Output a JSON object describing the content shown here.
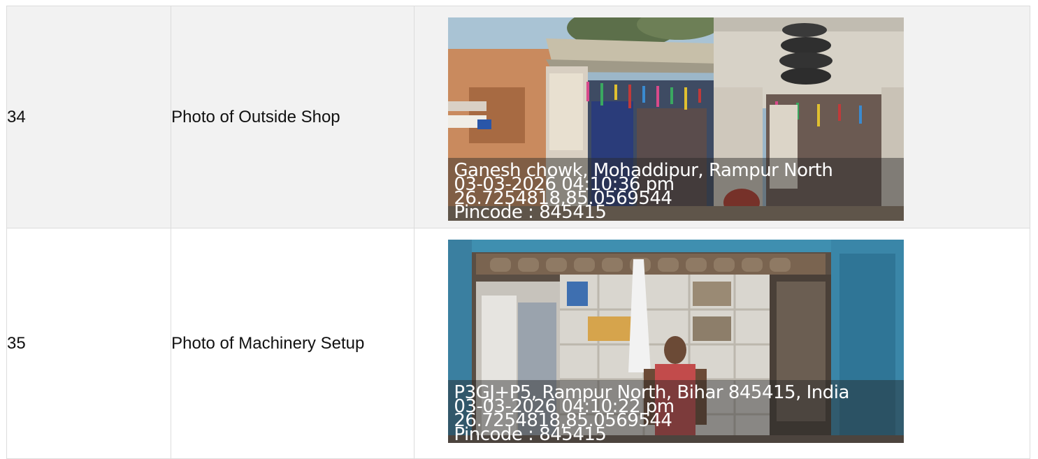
{
  "rows": [
    {
      "number": "34",
      "label": "Photo of Outside Shop",
      "photo": {
        "subject": "shop-exterior",
        "stamp_lines": [
          "Ganesh chowk, Mohaddipur, Rampur North",
          "03-03-2026 04:10:36 pm",
          "26.7254818,85.0569544",
          "Pincode : 845415"
        ]
      }
    },
    {
      "number": "35",
      "label": "Photo of Machinery Setup",
      "photo": {
        "subject": "shop-interior-with-person",
        "stamp_lines": [
          "P3GJ+P5, Rampur North, Bihar 845415, India",
          "03-03-2026 04:10:22 pm",
          "26.7254818,85.0569544",
          "Pincode : 845415"
        ]
      }
    }
  ],
  "colors": {
    "border": "#dcdcdc",
    "row_alt_bg": "#f2f2f2",
    "stamp_text": "#ffffff"
  }
}
